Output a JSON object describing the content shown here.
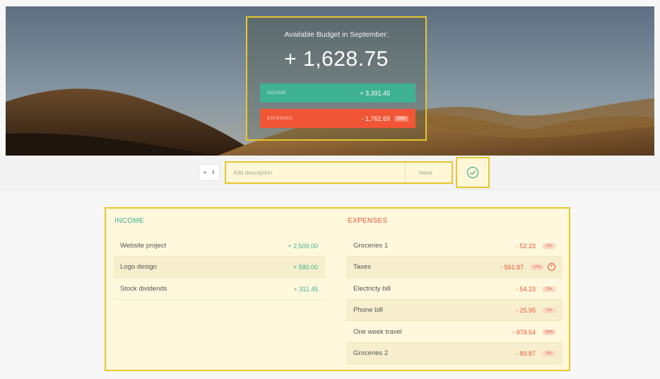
{
  "header": {
    "title": "Available Budget in September:",
    "budget": "+ 1,628.75",
    "income": {
      "label": "INCOME",
      "value": "+ 3,391.45"
    },
    "expenses": {
      "label": "EXPENSES",
      "value": "- 1,762.69",
      "percentage": "52%"
    }
  },
  "add": {
    "type_symbol": "+",
    "type_arrows": "⇕",
    "description_placeholder": "Add description",
    "value_placeholder": "Value",
    "submit_icon": "check-circle-icon"
  },
  "income": {
    "title": "INCOME",
    "items": [
      {
        "description": "Website project",
        "value": "+ 2,500.00"
      },
      {
        "description": "Logo design",
        "value": "+ 580.00"
      },
      {
        "description": "Stock dividends",
        "value": "+ 311.45"
      }
    ]
  },
  "expenses": {
    "title": "EXPENSES",
    "items": [
      {
        "description": "Groceries 1",
        "value": "- 52.23",
        "percentage": "2%"
      },
      {
        "description": "Taxes",
        "value": "- 561.87",
        "percentage": "17%"
      },
      {
        "description": "Electricty bill",
        "value": "- 54.23",
        "percentage": "2%"
      },
      {
        "description": "Phone bill",
        "value": "- 25.95",
        "percentage": "1%"
      },
      {
        "description": "One week travel",
        "value": "- 978.54",
        "percentage": "29%"
      },
      {
        "description": "Groceries 2",
        "value": "- 89.87",
        "percentage": "3%"
      }
    ]
  },
  "colors": {
    "income": "#3fb291",
    "expenses": "#f05536",
    "highlight": "#e6c72c"
  }
}
